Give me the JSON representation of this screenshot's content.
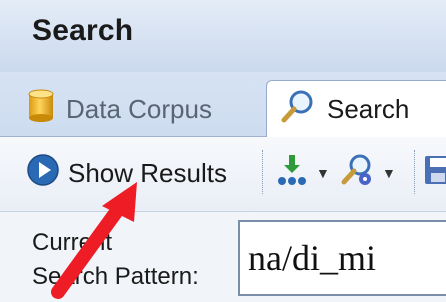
{
  "window": {
    "title": "Search"
  },
  "tabs": [
    {
      "label": "Data Corpus",
      "icon": "database-cylinder-icon",
      "active": false
    },
    {
      "label": "Search",
      "icon": "magnifier-icon",
      "active": true
    }
  ],
  "toolbar": {
    "show_results_label": "Show Results",
    "show_results_icon": "play-circle-icon",
    "tools": [
      "branch-options-icon",
      "search-options-icon",
      "save-icon"
    ]
  },
  "pattern": {
    "label_line1": "Current",
    "label_line2": "Search Pattern:",
    "value": "na/di_mi"
  },
  "annotation": {
    "arrow_color": "#ee1c24"
  }
}
